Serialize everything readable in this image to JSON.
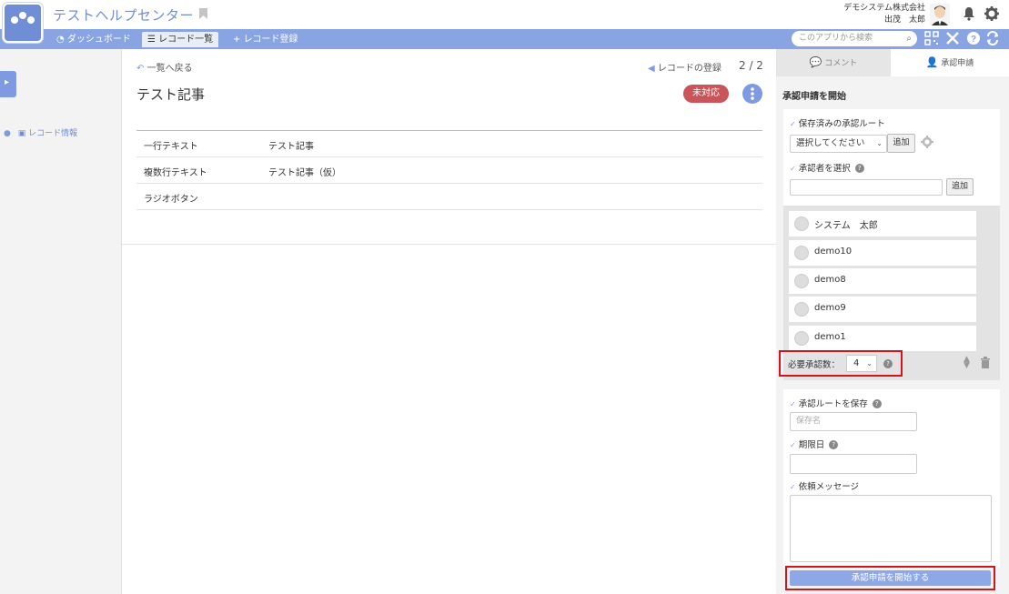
{
  "header": {
    "app_title": "テストヘルプセンター",
    "company": "デモシステム株式会社",
    "user_name": "出茂　太郎"
  },
  "nav": {
    "dashboard": "ダッシュボード",
    "record_list": "レコード一覧",
    "record_add": "レコード登録",
    "search_placeholder": "このアプリから検索"
  },
  "side": {
    "record_info": "レコード情報"
  },
  "main": {
    "back_label": "一覧へ戻る",
    "record_reg": "レコードの登録",
    "pager": "2 / 2",
    "title": "テスト記事",
    "status": "未対応",
    "fields": [
      {
        "label": "一行テキスト",
        "value": "テスト記事"
      },
      {
        "label": "複数行テキスト",
        "value": "テスト記事（仮）"
      },
      {
        "label": "ラジオボタン",
        "value": ""
      }
    ]
  },
  "panel": {
    "tab_comment": "コメント",
    "tab_approval": "承認申請",
    "title": "承認申請を開始",
    "saved_routes_label": "保存済みの承認ルート",
    "route_select": "選択してください",
    "add": "追加",
    "select_approver_label": "承認者を選択",
    "approvers": [
      "システム　太郎",
      "demo10",
      "demo8",
      "demo9",
      "demo1"
    ],
    "required_label": "必要承認数：",
    "required_value": "4",
    "save_route_label": "承認ルートを保存",
    "save_name_placeholder": "保存名",
    "due_label": "期限日",
    "message_label": "依頼メッセージ",
    "submit": "承認申請を開始する"
  }
}
